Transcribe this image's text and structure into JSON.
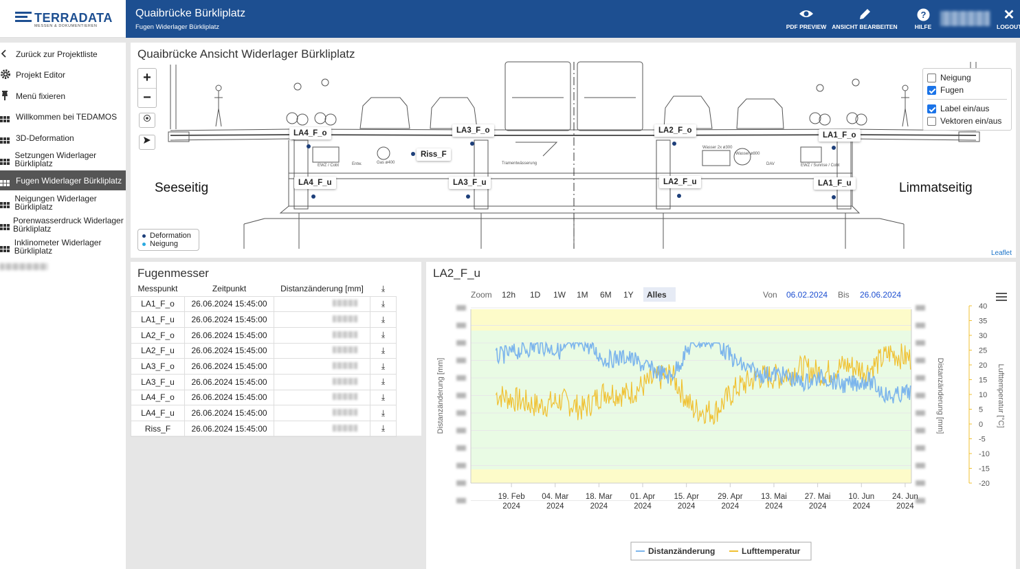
{
  "header": {
    "logo_text": "TERRADATA",
    "logo_sub": "MESSEN & DOKUMENTIEREN",
    "project_title": "Quaibrücke Bürkliplatz",
    "project_sub": "Fugen Widerlager Bürkliplatz",
    "pdf_label": "PDF PREVIEW",
    "edit_label": "ANSICHT BEARBEITEN",
    "help_label": "HILFE",
    "logout_label": "LOGOUT"
  },
  "sidebar": {
    "items": [
      {
        "label": "Zurück zur Projektliste"
      },
      {
        "label": "Projekt Editor"
      },
      {
        "label": "Menü fixieren"
      },
      {
        "label": "Willkommen bei TEDAMOS"
      },
      {
        "label": "3D-Deformation"
      },
      {
        "label": "Setzungen Widerlager Bürkliplatz"
      },
      {
        "label": "Fugen Widerlager Bürkliplatz"
      },
      {
        "label": "Neigungen Widerlager Bürkliplatz"
      },
      {
        "label": "Porenwasserdruck Widerlager Bürkliplatz"
      },
      {
        "label": "Inklinometer Widerlager Bürkliplatz"
      }
    ]
  },
  "map": {
    "title": "Quaibrücke Ansicht Widerlager Bürkliplatz",
    "zoom_in": "+",
    "zoom_out": "−",
    "layers": [
      {
        "label": "Neigung",
        "checked": false
      },
      {
        "label": "Fugen",
        "checked": true
      },
      {
        "label": "Label ein/aus",
        "checked": true
      },
      {
        "label": "Vektoren ein/aus",
        "checked": false
      }
    ],
    "legend": [
      {
        "label": "Deformation",
        "color": "#1d3f7a"
      },
      {
        "label": "Neigung",
        "color": "#2aa9e0"
      }
    ],
    "left_side": "Seeseitig",
    "right_side": "Limmatseitig",
    "attribution": "Leaflet",
    "points": [
      "LA4_F_o",
      "LA3_F_o",
      "LA2_F_o",
      "LA1_F_o",
      "Riss_F",
      "LA4_F_u",
      "LA3_F_u",
      "LA2_F_u",
      "LA1_F_u"
    ],
    "drawing_notes": [
      "EWZ / Cobt",
      "Entw.",
      "Gas ø400",
      "Tramentwässerung",
      "Wasser 2x ø300",
      "Wasser ø800",
      "DAV",
      "EWZ / Sunrise / Cobt"
    ]
  },
  "fugenmesser": {
    "title": "Fugenmesser",
    "columns": [
      "Messpunkt",
      "Zeitpunkt",
      "Distanzänderung [mm]"
    ],
    "rows": [
      {
        "point": "LA1_F_o",
        "time": "26.06.2024 15:45:00"
      },
      {
        "point": "LA1_F_u",
        "time": "26.06.2024 15:45:00"
      },
      {
        "point": "LA2_F_o",
        "time": "26.06.2024 15:45:00"
      },
      {
        "point": "LA2_F_u",
        "time": "26.06.2024 15:45:00"
      },
      {
        "point": "LA3_F_o",
        "time": "26.06.2024 15:45:00"
      },
      {
        "point": "LA3_F_u",
        "time": "26.06.2024 15:45:00"
      },
      {
        "point": "LA4_F_o",
        "time": "26.06.2024 15:45:00"
      },
      {
        "point": "LA4_F_u",
        "time": "26.06.2024 15:45:00"
      },
      {
        "point": "Riss_F",
        "time": "26.06.2024 15:45:00"
      }
    ]
  },
  "chart": {
    "title": "LA2_F_u",
    "zoom_label": "Zoom",
    "zoom_buttons": [
      "12h",
      "1D",
      "1W",
      "1M",
      "6M",
      "1Y",
      "Alles"
    ],
    "active_zoom": "Alles",
    "from_label": "Von",
    "from_date": "06.02.2024",
    "to_label": "Bis",
    "to_date": "26.06.2024",
    "left_axis_label": "Distanzänderung [mm]",
    "right_axis_label": "Distanzänderung [mm]",
    "temp_axis_label": "Lufttemperatur [°C]",
    "x_ticks": [
      {
        "day": "19. Feb",
        "year": "2024"
      },
      {
        "day": "04. Mar",
        "year": "2024"
      },
      {
        "day": "18. Mar",
        "year": "2024"
      },
      {
        "day": "01. Apr",
        "year": "2024"
      },
      {
        "day": "15. Apr",
        "year": "2024"
      },
      {
        "day": "29. Apr",
        "year": "2024"
      },
      {
        "day": "13. Mai",
        "year": "2024"
      },
      {
        "day": "27. Mai",
        "year": "2024"
      },
      {
        "day": "10. Jun",
        "year": "2024"
      },
      {
        "day": "24. Jun",
        "year": "2024"
      }
    ],
    "temp_ticks": [
      "40",
      "35",
      "30",
      "25",
      "20",
      "15",
      "10",
      "5",
      "0",
      "-5",
      "-10",
      "-15",
      "-20"
    ],
    "colors": {
      "distance": "#7cb5ec",
      "temperature": "#f0c030",
      "green_band": "#e9fbe4",
      "yellow_band": "#fdfbc9"
    }
  },
  "chart_data": {
    "type": "line",
    "x_range": [
      "2024-02-06",
      "2024-06-26"
    ],
    "temp_ylim": [
      -20,
      40
    ],
    "series": [
      {
        "name": "Lufttemperatur",
        "axis": "right",
        "unit": "°C",
        "x": [
          "2024-02-14",
          "2024-02-21",
          "2024-02-28",
          "2024-03-06",
          "2024-03-13",
          "2024-03-20",
          "2024-03-27",
          "2024-04-03",
          "2024-04-10",
          "2024-04-17",
          "2024-04-24",
          "2024-05-01",
          "2024-05-08",
          "2024-05-15",
          "2024-05-22",
          "2024-05-29",
          "2024-06-05",
          "2024-06-12",
          "2024-06-19",
          "2024-06-26"
        ],
        "values": [
          10,
          8,
          6,
          8,
          5,
          11,
          10,
          14,
          17,
          5,
          4,
          12,
          16,
          16,
          19,
          17,
          20,
          18,
          24,
          22
        ]
      },
      {
        "name": "Distanzänderung",
        "axis": "left",
        "unit": "mm",
        "x": [
          "2024-02-06",
          "2024-02-14",
          "2024-02-21",
          "2024-02-28",
          "2024-03-06",
          "2024-03-13",
          "2024-03-20",
          "2024-03-27",
          "2024-04-03",
          "2024-04-10",
          "2024-04-17",
          "2024-04-24",
          "2024-05-01",
          "2024-05-08",
          "2024-05-15",
          "2024-05-22",
          "2024-05-29",
          "2024-06-05",
          "2024-06-12",
          "2024-06-19",
          "2024-06-26"
        ],
        "values": null
      }
    ]
  }
}
